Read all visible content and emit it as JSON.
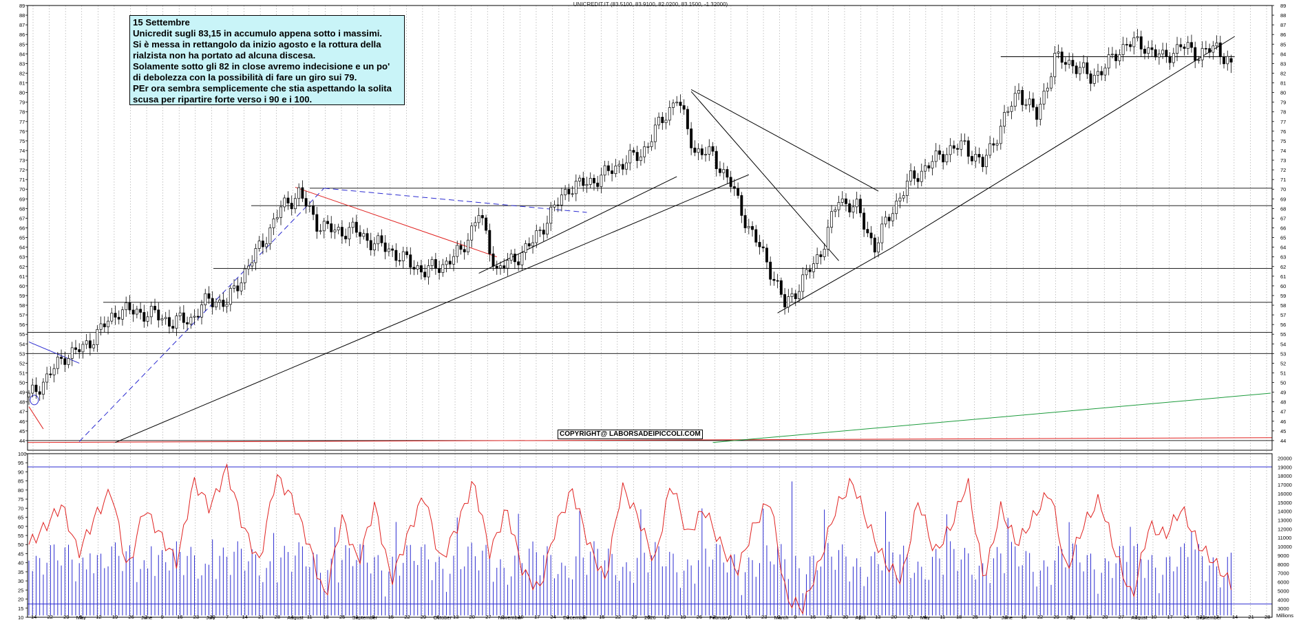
{
  "header": {
    "title": "UNICREDIT.IT (83.5100, 83.9100, 82.0200, 83.1500, -1.32000)"
  },
  "annotation": {
    "lines": [
      "15 Settembre",
      "Unicredit sugli 83,15 in accumulo appena sotto i massimi.",
      "Si è messa in rettangolo da inizio agosto e la rottura della",
      "rialzista non ha portato ad alcuna discesa.",
      "Solamente sotto gli 82 in close avremo indecisione e un po'",
      "di debolezza con la possibilità di fare un giro sui 79.",
      "PEr ora sembra semplicemente che stia aspettando la solita",
      "scusa per ripartire forte verso i 90 e i 100."
    ]
  },
  "copyright": "COPYRIGHT@ LABORSADEIPICCOLI.COM",
  "colors": {
    "candle": "#000000",
    "oscillator": "#e0201e",
    "volume": "#2a2ad0",
    "support_line": "#000000",
    "trend_red": "#e0201e",
    "trend_blue": "#2a2ad0",
    "trend_green": "#1a9a3a",
    "note_bg": "#c9f4f8"
  },
  "chart_data": {
    "type": "candlestick",
    "symbol": "UNICREDIT.IT",
    "last": {
      "open": 83.51,
      "high": 83.91,
      "low": 82.02,
      "close": 83.15,
      "change": -1.32
    },
    "price_axis": {
      "ylim": [
        43,
        89
      ],
      "ticks": [
        44,
        45,
        46,
        47,
        48,
        49,
        50,
        51,
        52,
        53,
        54,
        55,
        56,
        57,
        58,
        59,
        60,
        61,
        62,
        63,
        64,
        65,
        66,
        67,
        68,
        69,
        70,
        71,
        72,
        73,
        74,
        75,
        76,
        77,
        78,
        79,
        80,
        81,
        82,
        83,
        84,
        85,
        86,
        87,
        88,
        89
      ]
    },
    "oscillator_axis": {
      "ylim": [
        10,
        100
      ],
      "ticks": [
        10,
        15,
        20,
        25,
        30,
        35,
        40,
        45,
        50,
        55,
        60,
        65,
        70,
        75,
        80,
        85,
        90,
        95,
        100
      ]
    },
    "volume_axis": {
      "ylim": [
        2000,
        20500
      ],
      "ticks": [
        3000,
        4000,
        5000,
        6000,
        7000,
        8000,
        9000,
        10000,
        11000,
        12000,
        13000,
        14000,
        15000,
        16000,
        17000,
        18000,
        19000,
        20000
      ]
    },
    "volume_axis_label": "Millions",
    "x_ticks": [
      "14",
      "22",
      "29",
      "5",
      "12",
      "19",
      "26",
      "2",
      "9",
      "16",
      "23",
      "30",
      "7",
      "14",
      "21",
      "28",
      "4",
      "11",
      "18",
      "25",
      "1",
      "8",
      "15",
      "22",
      "29",
      "6",
      "13",
      "20",
      "27",
      "3",
      "10",
      "17",
      "24",
      "1",
      "8",
      "15",
      "22",
      "29",
      "5",
      "12",
      "19",
      "26",
      "2",
      "9",
      "16",
      "23",
      "2",
      "9",
      "16",
      "23",
      "30",
      "6",
      "13",
      "20",
      "27",
      "4",
      "11",
      "18",
      "25",
      "1",
      "8",
      "15",
      "22",
      "29",
      "6",
      "13",
      "20",
      "27",
      "3",
      "10",
      "17",
      "24",
      "31",
      "7",
      "14",
      "21",
      "28"
    ],
    "month_labels": [
      "May",
      "June",
      "July",
      "August",
      "September",
      "October",
      "November",
      "December",
      "2026",
      "February",
      "March",
      "April",
      "May",
      "June",
      "July",
      "August",
      "September"
    ],
    "horizontal_levels": [
      44,
      53,
      55.2,
      58.3,
      61.8,
      68.3,
      70.1
    ],
    "candles_weekly_summary": [
      {
        "d": 0,
        "c": 48.5
      },
      {
        "d": 5,
        "c": 50.5
      },
      {
        "d": 10,
        "c": 52.8
      },
      {
        "d": 15,
        "c": 53.5
      },
      {
        "d": 20,
        "c": 55.5
      },
      {
        "d": 25,
        "c": 57.5
      },
      {
        "d": 30,
        "c": 57.3
      },
      {
        "d": 35,
        "c": 57.0
      },
      {
        "d": 40,
        "c": 56.2
      },
      {
        "d": 45,
        "c": 56.6
      },
      {
        "d": 50,
        "c": 58.6
      },
      {
        "d": 55,
        "c": 58.2
      },
      {
        "d": 60,
        "c": 61.5
      },
      {
        "d": 65,
        "c": 64.5
      },
      {
        "d": 70,
        "c": 68.0
      },
      {
        "d": 75,
        "c": 69.6
      },
      {
        "d": 80,
        "c": 66.5
      },
      {
        "d": 85,
        "c": 65.6
      },
      {
        "d": 90,
        "c": 65.8
      },
      {
        "d": 95,
        "c": 64.6
      },
      {
        "d": 100,
        "c": 63.8
      },
      {
        "d": 105,
        "c": 62.5
      },
      {
        "d": 110,
        "c": 61.5
      },
      {
        "d": 115,
        "c": 62.2
      },
      {
        "d": 120,
        "c": 63.5
      },
      {
        "d": 125,
        "c": 67.5
      },
      {
        "d": 130,
        "c": 61.6
      },
      {
        "d": 135,
        "c": 62.8
      },
      {
        "d": 140,
        "c": 64.5
      },
      {
        "d": 145,
        "c": 67.5
      },
      {
        "d": 150,
        "c": 70.2
      },
      {
        "d": 155,
        "c": 70.6
      },
      {
        "d": 160,
        "c": 71.5
      },
      {
        "d": 165,
        "c": 72.8
      },
      {
        "d": 170,
        "c": 73.6
      },
      {
        "d": 175,
        "c": 76.6
      },
      {
        "d": 180,
        "c": 79.5
      },
      {
        "d": 185,
        "c": 74.0
      },
      {
        "d": 190,
        "c": 73.5
      },
      {
        "d": 195,
        "c": 70.5
      },
      {
        "d": 200,
        "c": 66.0
      },
      {
        "d": 205,
        "c": 62.6
      },
      {
        "d": 210,
        "c": 58.0
      },
      {
        "d": 215,
        "c": 60.5
      },
      {
        "d": 220,
        "c": 63.5
      },
      {
        "d": 225,
        "c": 69.0
      },
      {
        "d": 230,
        "c": 68.0
      },
      {
        "d": 235,
        "c": 64.0
      },
      {
        "d": 240,
        "c": 68.0
      },
      {
        "d": 245,
        "c": 71.0
      },
      {
        "d": 250,
        "c": 72.5
      },
      {
        "d": 255,
        "c": 74.0
      },
      {
        "d": 260,
        "c": 74.5
      },
      {
        "d": 265,
        "c": 72.5
      },
      {
        "d": 270,
        "c": 76.5
      },
      {
        "d": 275,
        "c": 80.2
      },
      {
        "d": 280,
        "c": 77.5
      },
      {
        "d": 285,
        "c": 83.5
      },
      {
        "d": 290,
        "c": 83.0
      },
      {
        "d": 295,
        "c": 81.5
      },
      {
        "d": 300,
        "c": 83.0
      },
      {
        "d": 305,
        "c": 85.2
      },
      {
        "d": 310,
        "c": 84.8
      },
      {
        "d": 315,
        "c": 83.5
      },
      {
        "d": 320,
        "c": 84.8
      },
      {
        "d": 325,
        "c": 84.0
      },
      {
        "d": 330,
        "c": 84.6
      },
      {
        "d": 334,
        "c": 83.15
      }
    ],
    "oscillator_series_summary": [
      50,
      60,
      72,
      45,
      65,
      80,
      35,
      70,
      55,
      40,
      85,
      70,
      92,
      60,
      40,
      88,
      75,
      50,
      20,
      65,
      40,
      72,
      30,
      55,
      78,
      40,
      60,
      85,
      45,
      70,
      35,
      25,
      60,
      80,
      50,
      30,
      82,
      65,
      40,
      85,
      55,
      70,
      50,
      35,
      60,
      75,
      20,
      15,
      40,
      70,
      85,
      60,
      40,
      30,
      75,
      45,
      60,
      85,
      30,
      70,
      50,
      65,
      80,
      35,
      60,
      75,
      45,
      20,
      60,
      55,
      70,
      50,
      40,
      28
    ]
  }
}
